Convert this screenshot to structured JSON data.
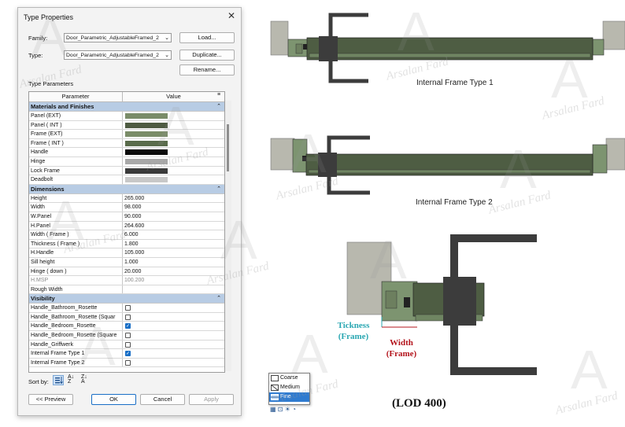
{
  "dialog": {
    "title": "Type Properties",
    "family_label": "Family:",
    "family_value": "Door_Parametric_AdjustableFramed_2",
    "type_label": "Type:",
    "type_value": "Door_Parametric_AdjustableFramed_2",
    "load_button": "Load...",
    "duplicate_button": "Duplicate...",
    "rename_button": "Rename...",
    "type_parameters_label": "Type Parameters",
    "col_parameter": "Parameter",
    "col_value": "Value",
    "sections": [
      {
        "title": "Materials and Finishes",
        "rows": [
          {
            "name": "Panel (EXT)",
            "swatch": "#7a8c68"
          },
          {
            "name": "Panel ( INT )",
            "swatch": "#4e5b42"
          },
          {
            "name": "Frame (EXT)",
            "swatch": "#7a8c68"
          },
          {
            "name": "Frame ( INT )",
            "swatch": "#596b4b"
          },
          {
            "name": "Handle",
            "swatch": "#0a0a0a"
          },
          {
            "name": "Hinge",
            "swatch": "#a8a8a8"
          },
          {
            "name": "Lock Frame",
            "swatch": "#3a3a3a"
          },
          {
            "name": "Deadbolt",
            "swatch": "#c8c8c8"
          }
        ]
      },
      {
        "title": "Dimensions",
        "rows": [
          {
            "name": "Height",
            "value": "265.000"
          },
          {
            "name": "Width",
            "value": "98.000"
          },
          {
            "name": "W.Panel",
            "value": "90.000"
          },
          {
            "name": "H.Panel",
            "value": "264.600"
          },
          {
            "name": "Width (  Frame )",
            "value": "6.000"
          },
          {
            "name": "Thickness ( Frame )",
            "value": "1.800"
          },
          {
            "name": "H.Handle",
            "value": "105.000"
          },
          {
            "name": "Sill height",
            "value": "1.000"
          },
          {
            "name": "Hinge ( down )",
            "value": "20.000"
          },
          {
            "name": "H.MSP",
            "value": "100.200",
            "dim": true
          },
          {
            "name": "Rough Width",
            "value": ""
          }
        ]
      },
      {
        "title": "Visibility",
        "rows": [
          {
            "name": "Handle_Bathroom_Rosette",
            "checked": false
          },
          {
            "name": "Handle_Bathroom_Rosette (Squar",
            "checked": false
          },
          {
            "name": "Handle_Bedroom_Rosette",
            "checked": true
          },
          {
            "name": "Handle_Bedroom_Rosette (Square",
            "checked": false
          },
          {
            "name": "Handle_Griffwerk",
            "checked": false
          },
          {
            "name": "Internal Frame Type 1",
            "checked": true
          },
          {
            "name": "Internal Frame Type 2",
            "checked": false
          }
        ]
      }
    ],
    "sort_by_label": "Sort by:",
    "preview_button": "<< Preview",
    "ok_button": "OK",
    "cancel_button": "Cancel",
    "apply_button": "Apply"
  },
  "illustration": {
    "caption_type1": "Internal Frame Type 1",
    "caption_type2": "Internal Frame Type 2",
    "thickness_label": "Tickness (Frame)",
    "width_label": "Width (Frame)",
    "lod_label": "(LOD 400)",
    "detail_menu": [
      "Coarse",
      "Medium",
      "Fine"
    ],
    "detail_selected": "Fine",
    "watermark": "Arsalan Fard",
    "colors": {
      "panel": "#4e5d43",
      "frame": "#7d9470",
      "handle": "#3c3c3c",
      "wall": "#b4b4a8",
      "thickness_text": "#2aa7b2",
      "width_text": "#b3141c",
      "menu_selected": "#2f7bd0"
    }
  }
}
